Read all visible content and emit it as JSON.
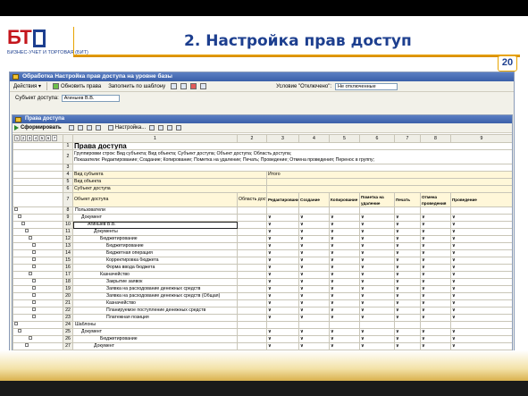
{
  "slide": {
    "title": "2.  Настройка прав доступ",
    "page_number": "20",
    "logo_mark": "БТ",
    "logo_subtitle": "БИЗНЕС-УЧЕТ И ТОРГОВАЯ (БИТ)"
  },
  "window": {
    "title": "Обработка  Настройка прав доступа на уровне базы",
    "toolbar": {
      "actions_label": "Действия ▾",
      "refresh_label": "Обновить права",
      "fill_label": "Заполнить по шаблону",
      "condition_label": "Условие \"Отключено\":",
      "condition_value": "Не отключенные"
    },
    "subject_label": "Субъект доступа:",
    "subject_value": "Агиныев В.В."
  },
  "subwindow": {
    "title": "Права доступа",
    "generate_label": "Сформировать",
    "settings_label": "Настройка..."
  },
  "grid": {
    "col_numbers": [
      "1",
      "2",
      "3",
      "4",
      "5",
      "6",
      "7",
      "8",
      "9"
    ],
    "level_buttons": [
      "1",
      "2",
      "3",
      "4",
      "5",
      "6",
      "7"
    ],
    "header_title": "Права доступа",
    "header_grouping": "Группировки строк: Вид субъекта; Вид объекта; Субъект доступа; Объект доступа; Область доступа;",
    "header_indicators": "Показатели: Редактирование; Создание; Копирование; Пометка на удаление; Печать; Проведение; Отмена проведения; Перенос в группу;",
    "row4": "Вид субъекта",
    "row4_itogo": "Итого",
    "row5": "Вид объекта",
    "row6": "Субъект доступа",
    "row7": "Объект доступа",
    "row7_area": "Область доступа",
    "col_headers": [
      "Редактирование",
      "Создание",
      "Копирование",
      "Пометка на удаление",
      "Печать",
      "Отмена проведения",
      "Проведение"
    ],
    "check": "∨",
    "rows": [
      {
        "n": "8",
        "text": "Пользователи",
        "indent": 0,
        "marks": false,
        "bold": false
      },
      {
        "n": "9",
        "text": "Документ",
        "indent": 1,
        "marks": true,
        "bold": false
      },
      {
        "n": "10",
        "text": "Агиныев В.В.",
        "indent": 2,
        "marks": true,
        "bold": false,
        "selected": true
      },
      {
        "n": "11",
        "text": "Документы",
        "indent": 3,
        "marks": true,
        "bold": false
      },
      {
        "n": "12",
        "text": "Бюджетирование",
        "indent": 4,
        "marks": true,
        "bold": false
      },
      {
        "n": "13",
        "text": "Бюджетирование",
        "indent": 5,
        "marks": true,
        "bold": false
      },
      {
        "n": "14",
        "text": "Бюджетная операция",
        "indent": 5,
        "marks": true,
        "bold": false
      },
      {
        "n": "15",
        "text": "Корректировка бюджета",
        "indent": 5,
        "marks": true,
        "bold": false
      },
      {
        "n": "16",
        "text": "Форма ввода бюджета",
        "indent": 5,
        "marks": true,
        "bold": false
      },
      {
        "n": "17",
        "text": "Казначейство",
        "indent": 4,
        "marks": true,
        "bold": false
      },
      {
        "n": "18",
        "text": "Закрытие заявок",
        "indent": 5,
        "marks": true,
        "bold": false
      },
      {
        "n": "19",
        "text": "Заявка на расходование денежных средств",
        "indent": 5,
        "marks": true,
        "bold": false
      },
      {
        "n": "20",
        "text": "Заявка на расходование денежных средств (Общая)",
        "indent": 5,
        "marks": true,
        "bold": false
      },
      {
        "n": "21",
        "text": "Казначейство",
        "indent": 5,
        "marks": true,
        "bold": false
      },
      {
        "n": "22",
        "text": "Планируемое поступление денежных средств",
        "indent": 5,
        "marks": true,
        "bold": false
      },
      {
        "n": "23",
        "text": "Платежная позиция",
        "indent": 5,
        "marks": true,
        "bold": false
      },
      {
        "n": "24",
        "text": "Шаблоны",
        "indent": 0,
        "marks": false,
        "bold": false
      },
      {
        "n": "25",
        "text": "Документ",
        "indent": 1,
        "marks": true,
        "bold": false
      },
      {
        "n": "26",
        "text": "Бюджетирование",
        "indent": 4,
        "marks": true,
        "bold": false
      },
      {
        "n": "27",
        "text": "Документ",
        "indent": 3,
        "marks": true,
        "bold": false
      }
    ]
  }
}
